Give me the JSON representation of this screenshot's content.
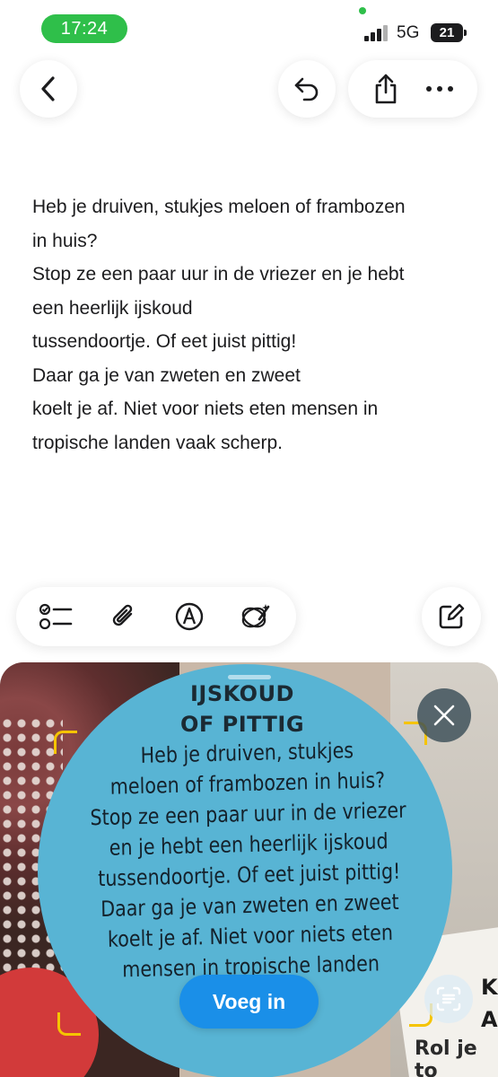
{
  "status_bar": {
    "time": "17:24",
    "network": "5G",
    "battery": "21"
  },
  "nav": {
    "back_icon": "chevron-left-icon",
    "undo_icon": "undo-icon",
    "share_icon": "share-icon",
    "more_icon": "more-icon"
  },
  "note": {
    "lines": [
      "Heb je druiven, stukjes meloen of frambozen",
      "in huis?",
      "Stop ze een paar uur in de vriezer en je hebt",
      "een heerlijk ijskoud",
      "tussendoortje. Of eet juist pittig!",
      "Daar ga je van zweten en zweet",
      "koelt je af. Niet voor niets eten mensen in",
      "tropische landen vaak scherp."
    ]
  },
  "toolbar": {
    "checklist_icon": "checklist-icon",
    "attachment_icon": "paperclip-icon",
    "markup_icon": "pen-circle-icon",
    "ai_icon": "writing-tools-icon",
    "compose_icon": "compose-icon"
  },
  "scanner": {
    "heading_lines": [
      "IJSKOUD",
      "OF PITTIG"
    ],
    "text_lines": [
      "Heb je druiven, stukjes",
      "meloen of frambozen in huis?",
      "Stop ze een paar uur in de vriezer",
      "en je hebt een heerlijk ijskoud",
      "tussendoortje. Of eet juist pittig!",
      "Daar ga je van zweten en zweet",
      "koelt je af. Niet voor niets eten",
      "mensen in tropische landen"
    ],
    "side_heading": "K\nA",
    "side_text": "Rol je to",
    "insert_label": "Voeg in",
    "close_icon": "close-icon",
    "live_text_icon": "live-text-icon"
  },
  "colors": {
    "time_pill": "#2fbf4a",
    "insert_button": "#1a8fe8",
    "scan_corners": "#f5c400",
    "disc": "#58b4d4"
  }
}
